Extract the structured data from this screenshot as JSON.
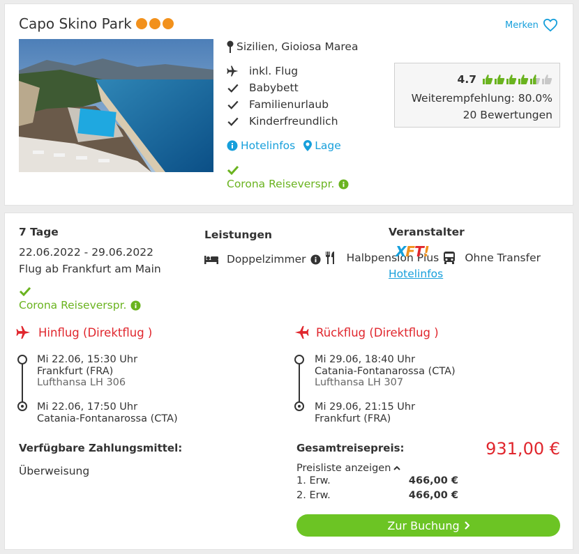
{
  "hotel": {
    "name": "Capo Skino Park",
    "stars": 3,
    "merken_label": "Merken",
    "location": "Sizilien, Gioiosa Marea",
    "features": [
      "inkl. Flug",
      "Babybett",
      "Familienurlaub",
      "Kinderfreundlich"
    ],
    "links": {
      "hotelinfos": "Hotelinfos",
      "lage": "Lage"
    },
    "corona": "Corona Reiseverspr.",
    "rating": {
      "score": "4.7",
      "thumbs_filled": 4.5,
      "thumbs_total": 6,
      "recommendation": "Weiterempfehlung: 80.0%",
      "reviews": "20 Bewertungen"
    },
    "colors": {
      "stars": "#f2911c",
      "link": "#169fdb",
      "green": "#6ab31f"
    }
  },
  "offer": {
    "duration": "7 Tage",
    "dates": "22.06.2022 - 29.06.2022",
    "departure": "Flug ab Frankfurt am Main",
    "corona": "Corona Reiseverspr.",
    "services": {
      "heading": "Leistungen",
      "items": [
        {
          "icon": "bed-icon",
          "label": "Doppelzimmer"
        },
        {
          "icon": "cutlery-icon",
          "label": "Halbpension Plus"
        },
        {
          "icon": "bus-icon",
          "label": "Ohne Transfer"
        }
      ]
    },
    "operator": {
      "heading": "Veranstalter",
      "logo_text": "XFT!",
      "link": "Hotelinfos"
    },
    "outbound": {
      "title": "Hinflug (Direktflug )",
      "dep_time": "Mi 22.06, 15:30 Uhr",
      "dep_airport": "Frankfurt (FRA)",
      "airline": "Lufthansa LH 306",
      "arr_time": "Mi 22.06, 17:50 Uhr",
      "arr_airport": "Catania-Fontanarossa (CTA)"
    },
    "return": {
      "title": "Rückflug (Direktflug )",
      "dep_time": "Mi 29.06, 18:40 Uhr",
      "dep_airport": "Catania-Fontanarossa (CTA)",
      "airline": "Lufthansa LH 307",
      "arr_time": "Mi 29.06, 21:15 Uhr",
      "arr_airport": "Frankfurt (FRA)"
    },
    "payment": {
      "heading": "Verfügbare Zahlungsmittel:",
      "method": "Überweisung"
    },
    "pricing": {
      "heading": "Gesamtreisepreis:",
      "total": "931,00 €",
      "pricelist_label": "Preisliste anzeigen",
      "rows": [
        {
          "label": "1. Erw.",
          "price": "466,00 €"
        },
        {
          "label": "2. Erw.",
          "price": "466,00 €"
        }
      ]
    },
    "book_button": "Zur Buchung",
    "colors": {
      "flight_red": "#e0262d",
      "button_green": "#6cc424"
    }
  }
}
